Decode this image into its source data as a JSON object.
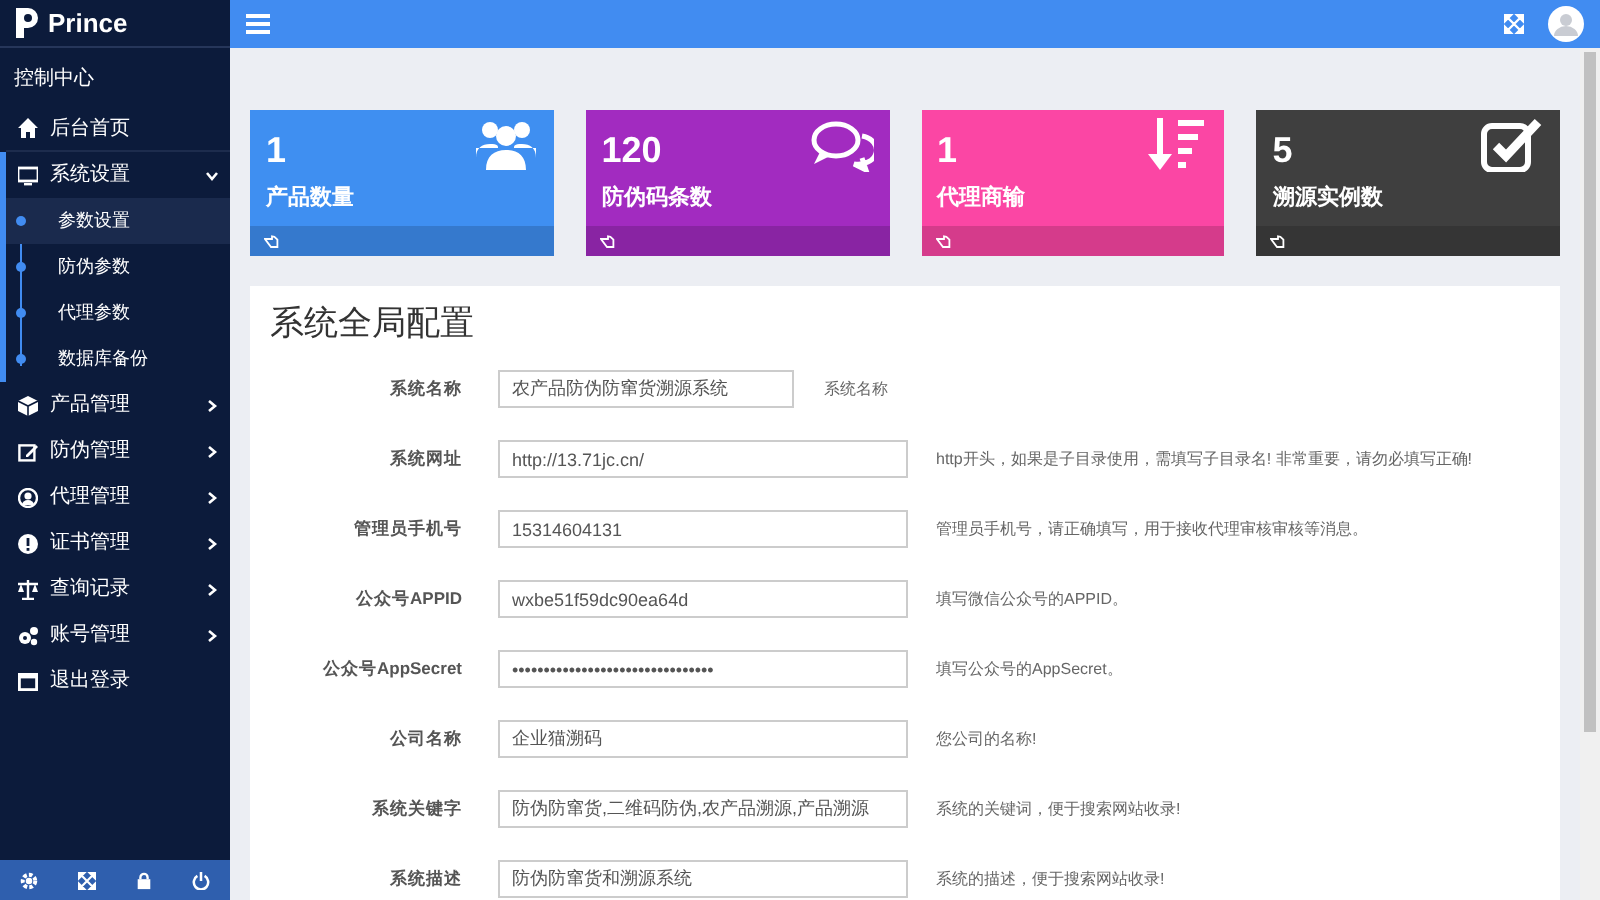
{
  "sidebar": {
    "brand": "Prince",
    "section_title": "控制中心",
    "items": [
      {
        "label": "后台首页",
        "kind": "link"
      },
      {
        "label": "系统设置",
        "kind": "menu",
        "expanded": true,
        "children": [
          {
            "label": "参数设置",
            "selected": true
          },
          {
            "label": "防伪参数",
            "selected": false
          },
          {
            "label": "代理参数",
            "selected": false
          },
          {
            "label": "数据库备份",
            "selected": false
          }
        ]
      },
      {
        "label": "产品管理",
        "kind": "menu",
        "expanded": false
      },
      {
        "label": "防伪管理",
        "kind": "menu",
        "expanded": false
      },
      {
        "label": "代理管理",
        "kind": "menu",
        "expanded": false
      },
      {
        "label": "证书管理",
        "kind": "menu",
        "expanded": false
      },
      {
        "label": "查询记录",
        "kind": "menu",
        "expanded": false
      },
      {
        "label": "账号管理",
        "kind": "menu",
        "expanded": false
      },
      {
        "label": "退出登录",
        "kind": "link"
      }
    ]
  },
  "stats": [
    {
      "value": "1",
      "label": "产品数量",
      "color": "#3f8ff1"
    },
    {
      "value": "120",
      "label": "防伪码条数",
      "color": "#a22bc0"
    },
    {
      "value": "1",
      "label": "代理商输",
      "color": "#fb46a4"
    },
    {
      "value": "5",
      "label": "溯源实例数",
      "color": "#3f3f3f"
    }
  ],
  "form": {
    "title": "系统全局配置",
    "fields": [
      {
        "label": "系统名称",
        "value": "农产品防伪防窜货溯源系统",
        "hint": "系统名称",
        "kind": "short"
      },
      {
        "label": "系统网址",
        "value": "http://13.71jc.cn/",
        "hint": "http开头，如果是子目录使用，需填写子目录名! 非常重要，请勿必填写正确!",
        "kind": "long"
      },
      {
        "label": "管理员手机号",
        "value": "15314604131",
        "hint": "管理员手机号，请正确填写，用于接收代理审核审核等消息。",
        "kind": "long"
      },
      {
        "label": "公众号APPID",
        "value": "wxbe51f59dc90ea64d",
        "hint": "填写微信公众号的APPID。",
        "kind": "long"
      },
      {
        "label": "公众号AppSecret",
        "value": "••••••••••••••••••••••••••••••••",
        "hint": "填写公众号的AppSecret。",
        "kind": "long"
      },
      {
        "label": "公司名称",
        "value": "企业猫溯码",
        "hint": "您公司的名称!",
        "kind": "long"
      },
      {
        "label": "系统关键字",
        "value": "防伪防窜货,二维码防伪,农产品溯源,产品溯源",
        "hint": "系统的关键词，便于搜索网站收录!",
        "kind": "long"
      },
      {
        "label": "系统描述",
        "value": "防伪防窜货和溯源系统",
        "hint": "系统的描述，便于搜索网站收录!",
        "kind": "long"
      }
    ]
  }
}
